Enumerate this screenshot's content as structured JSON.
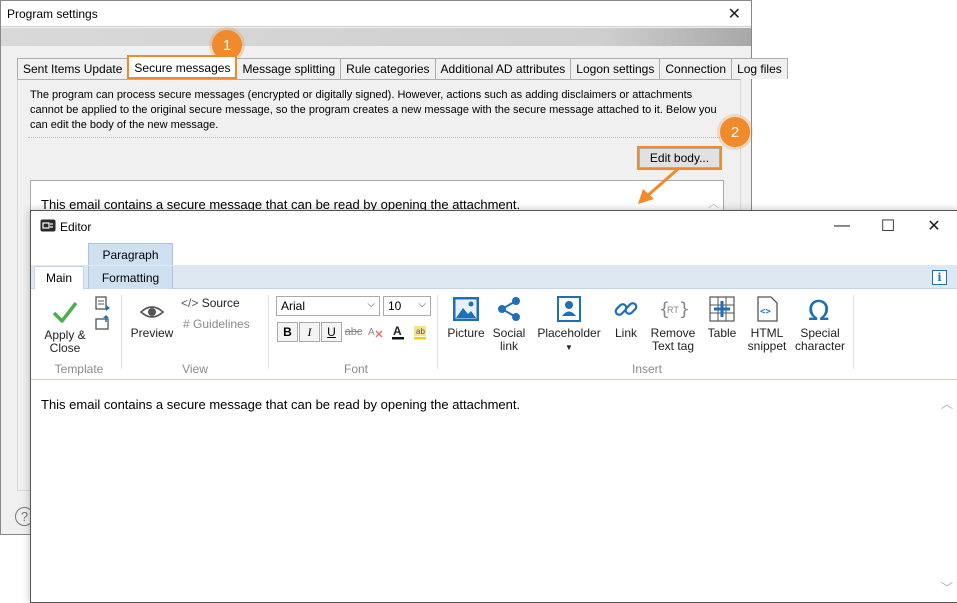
{
  "program_settings": {
    "title": "Program settings",
    "tabs": [
      "Sent Items Update",
      "Secure messages",
      "Message splitting",
      "Rule categories",
      "Additional AD attributes",
      "Logon settings",
      "Connection",
      "Log files"
    ],
    "active_tab": "Secure messages",
    "description": "The program can process secure messages (encrypted or digitally signed). However, actions such as adding disclaimers or attachments cannot be applied to the original secure message, so the program creates a new message with the secure message attached to it. Below you can edit the body of the new message.",
    "edit_body_label": "Edit body...",
    "body_text": "This email contains a secure message that can be read by opening the attachment.",
    "help_glyph": "?"
  },
  "callouts": {
    "step1": "1",
    "step2": "2"
  },
  "editor": {
    "title": "Editor",
    "context_tab": "Paragraph",
    "tabs": {
      "main": "Main",
      "formatting": "Formatting"
    },
    "info_glyph": "i",
    "groups": {
      "template": "Template",
      "view": "View",
      "font": "Font",
      "insert": "Insert"
    },
    "buttons": {
      "apply_close": [
        "Apply &",
        "Close"
      ],
      "preview": "Preview",
      "source": "Source",
      "guidelines": "Guidelines",
      "picture": "Picture",
      "social_link": [
        "Social",
        "link"
      ],
      "placeholder": "Placeholder",
      "link": "Link",
      "remove_text_tag": [
        "Remove",
        "Text tag"
      ],
      "table": "Table",
      "html_snippet": [
        "HTML",
        "snippet"
      ],
      "special_character": [
        "Special",
        "character"
      ]
    },
    "font": {
      "family": "Arial",
      "size": "10"
    },
    "format_buttons": {
      "bold": "B",
      "italic": "I",
      "underline": "U",
      "strike": "abc"
    },
    "content_text": "This email contains a secure message that can be read by opening the attachment."
  },
  "colors": {
    "accent": "#f08a2a",
    "ribbon_blue": "#1f6fb5",
    "green_check": "#4caf50"
  }
}
